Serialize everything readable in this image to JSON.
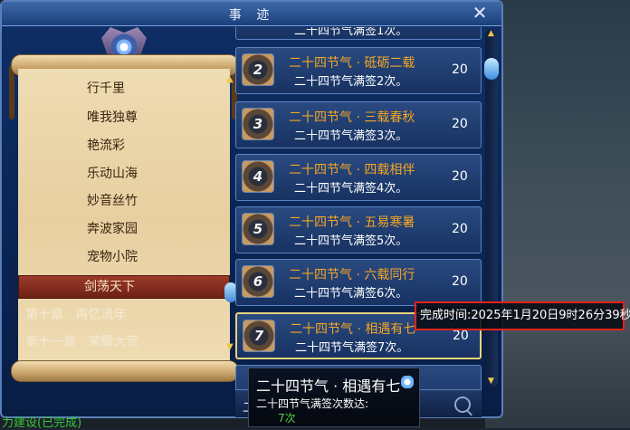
{
  "window": {
    "title": "事 迹",
    "close_icon": "close-icon"
  },
  "nav": {
    "items": [
      {
        "label": "行千里"
      },
      {
        "label": "唯我独尊"
      },
      {
        "label": "艳流彩"
      },
      {
        "label": "乐动山海"
      },
      {
        "label": "妙音丝竹"
      },
      {
        "label": "奔波家园"
      },
      {
        "label": "宠物小院"
      },
      {
        "label": "剑荡天下",
        "active": true
      }
    ],
    "chapters": [
      {
        "label": "第十章 · 再忆流年"
      },
      {
        "label": "第十一章 · 荣耀大荒"
      }
    ]
  },
  "top_card_fragment": "二十四节气满签1次。",
  "cards": [
    {
      "badge": "2",
      "title": "二十四节气 · 砥砺二载",
      "sub": "二十四节气满签2次。",
      "points": "20"
    },
    {
      "badge": "3",
      "title": "二十四节气 · 三载春秋",
      "sub": "二十四节气满签3次。",
      "points": "20"
    },
    {
      "badge": "4",
      "title": "二十四节气 · 四载相伴",
      "sub": "二十四节气满签4次。",
      "points": "20"
    },
    {
      "badge": "5",
      "title": "二十四节气 · 五易寒暑",
      "sub": "二十四节气满签5次。",
      "points": "20"
    },
    {
      "badge": "6",
      "title": "二十四节气 · 六载同行",
      "sub": "二十四节气满签6次。",
      "points": "20"
    },
    {
      "badge": "7",
      "title": "二十四节气 · 相遇有七",
      "sub": "二十四节气满签7次。",
      "points": "20",
      "highlight": true
    }
  ],
  "completion_tooltip": "完成时间:2025年1月20日9时26分39秒",
  "detail_tooltip": {
    "title": "二十四节气 · 相遇有七",
    "line": "二十四节气满签次数达:",
    "count": "7次"
  },
  "bottom": {
    "left_text": "力建设(已完成)",
    "partial_text": "二"
  },
  "colors": {
    "title_orange": "#f5a623",
    "highlight_border": "#e2231a",
    "count_green": "#4fd23f"
  }
}
